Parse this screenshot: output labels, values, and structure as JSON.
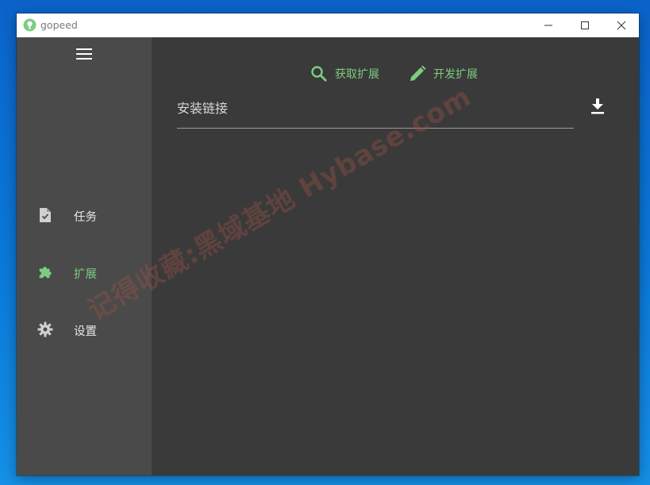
{
  "window": {
    "title": "gopeed",
    "logo_icon": "gopeed-logo-icon",
    "controls": [
      "minimize-icon",
      "maximize-icon",
      "close-icon"
    ]
  },
  "sidebar": {
    "menu_icon": "hamburger-menu-icon",
    "items": [
      {
        "label": "任务",
        "icon": "task-file-check-icon",
        "active": false
      },
      {
        "label": "扩展",
        "icon": "puzzle-piece-icon",
        "active": true
      },
      {
        "label": "设置",
        "icon": "gear-icon",
        "active": false
      }
    ]
  },
  "main": {
    "actions": [
      {
        "label": "获取扩展",
        "icon": "search-icon"
      },
      {
        "label": "开发扩展",
        "icon": "pencil-icon"
      }
    ],
    "install_placeholder": "安装链接",
    "install_button_icon": "download-icon"
  },
  "watermark": "记得收藏:黑域基地 Hybase.com",
  "colors": {
    "accent": "#7dcc7f",
    "sidebar_bg": "#4a4a4a",
    "main_bg": "#3a3a3a",
    "titlebar_bg": "#ffffff",
    "watermark": "#965046"
  }
}
